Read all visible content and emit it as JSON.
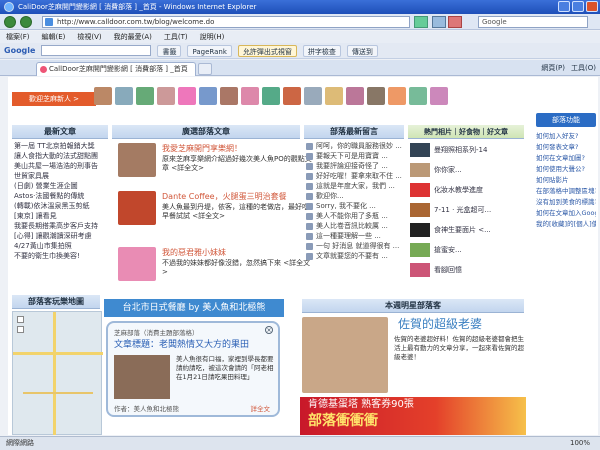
{
  "window": {
    "title": "CaliDoor芝麻開門變影網 [ 消費部落 ] _首頁 - Windows Internet Explorer"
  },
  "address": {
    "url": "http://www.calldoor.com.tw/blog/welcome.do",
    "search_placeholder": "Google"
  },
  "menu": [
    "檔案(F)",
    "編輯(E)",
    "檢視(V)",
    "我的最愛(A)",
    "工具(T)",
    "說明(H)"
  ],
  "google_toolbar": {
    "logo": "Google",
    "buttons": [
      "書籤",
      "PageRank",
      "允許彈出式視窗",
      "拼字檢查",
      "傳送到"
    ]
  },
  "tabs": {
    "active": "CallDoor芝麻開門變影網 [ 消費部落 ] _首頁",
    "tools": [
      "網頁(P)",
      "工具(O)"
    ]
  },
  "page": {
    "welcome": "歡迎芝麻新人 >",
    "latest_articles": {
      "title": "最新文章",
      "items": [
        "第一屆 TT北京拍報銷大獎",
        "讓人食指大動的法式甜點團",
        "美山共屋一場浩浩的刑事告",
        "世貿家具展",
        "(日劇) 營業生涯企圖",
        "Astos·法國餐點的傳統",
        "(轉載)依沐溫泉黑玉剪紙",
        "[東京] 讓看見",
        "我要長期搭乘高步客戶支持",
        "[心得] 讓觀潮讀深研考慮",
        "4/27黃山市集拍照",
        "不要的衛生巾換美容!"
      ]
    },
    "popular_articles": {
      "title": "廣選部落文章",
      "items": [
        {
          "title": "我愛芝麻開門享樂網！",
          "desc": "原來芝麻享樂網介紹過好幾次美人魚PO的觀點文章   <詳全文>"
        },
        {
          "title": "Dante Coffee，火腿蛋三明治套餐",
          "desc": "美人魚最到丹堤，依客，這種的老做店，最好吃早餐試試   <詳全文>"
        },
        {
          "title": "我的惡君雅小妹妹",
          "desc": "不過我的妹妹都好像沒錯，忽然搞下來  <詳全文>"
        }
      ]
    },
    "latest_comments": {
      "title": "部落最新留言",
      "items": [
        "阿呵，你的職員服務很妙 ...",
        "要報天下可是用寶寶 ...",
        "我要評論迎接奇怪了 ...",
        "好好吃喔！要拿來取不住 ...",
        "這就是年度大家，我們 ...",
        "歡迎你...",
        "Sorry, 我不要化 ...",
        "美人不能你用了多瓶 ...",
        "美人比卷音訊比較厲 ...",
        "這一種要理解一些 ...",
        "一句 好消息 就道得很有 ...",
        "文章就要您的不要有 ..."
      ]
    },
    "popular_photos": {
      "title": "熱門相片｜好食物｜好文章",
      "items": [
        "曼翔照相系列-14",
        "你你家...",
        "化妝水教學進度",
        "7-11 · 光盒超可...",
        "食神生要面片 <...",
        "搶蜜安...",
        "看腳回憶"
      ]
    },
    "sidebar": {
      "badge": "部落功能",
      "items": [
        "如何加入好友?",
        "如何發表文章?",
        "如何在文章加圖?",
        "如何使用大聲公?",
        "如何貼影片",
        "在部落格中調整區塊?",
        "沒有加到美食的標識?",
        "如何在文章加入Google地圖?",
        "我的[收藏]的[個人]使用的部落格?"
      ]
    },
    "map": {
      "title": "部落客玩樂地圖"
    },
    "blog_banner": "台北市日式餐廳 by 美人魚和北極熊",
    "popup": {
      "category": "芝麻部落（消費主題部落格）",
      "headline": "文章標題：老闆熱情又大方的果田",
      "text": "美人魚很有口福，家裡到學長都要請約請吃，被這次會請的「阿老相在1月21日請吃果田料理」",
      "author": "作者：美人魚和北極熊",
      "more": "詳全文"
    },
    "star_blog": {
      "title": "本週明星部落客",
      "name": "佐賀的超級老婆",
      "desc": "佐賀的老婆超好料！佐賀的超級老婆都會把生活上最有動力的文章分享，一起來看佐賀的超級老婆！"
    },
    "ad": {
      "line1": "肯德基蛋塔 熟客券90張",
      "line2": "部落衝衝衝"
    }
  },
  "status": {
    "text": "網際網路",
    "zoom": "100%"
  },
  "colors": {
    "accent": "#e35b2b",
    "blue_head": "#3f8ad0",
    "ie_blue": "#1e4fb8"
  }
}
